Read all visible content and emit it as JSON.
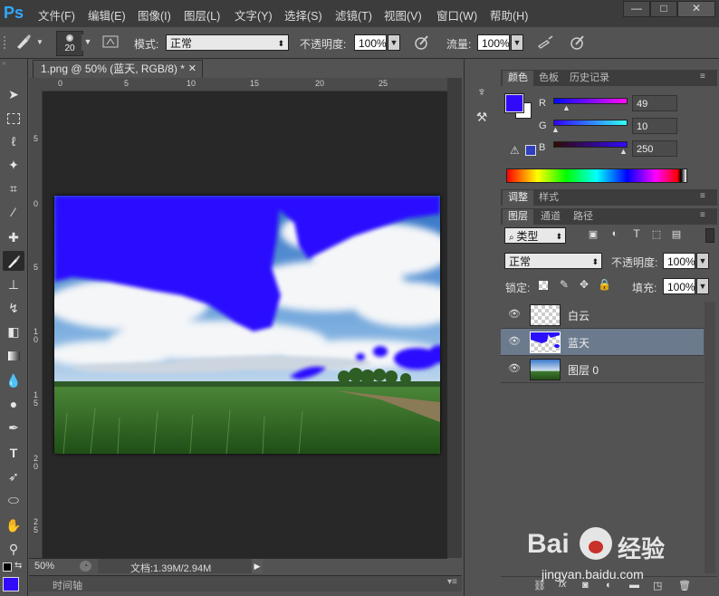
{
  "app": {
    "logo": "Ps"
  },
  "menu": [
    "文件(F)",
    "编辑(E)",
    "图像(I)",
    "图层(L)",
    "文字(Y)",
    "选择(S)",
    "滤镜(T)",
    "视图(V)",
    "窗口(W)",
    "帮助(H)"
  ],
  "window_controls": {
    "minimize": "—",
    "maximize": "□",
    "close": "✕"
  },
  "options": {
    "brush_size": "20",
    "mode_label": "模式:",
    "mode_value": "正常",
    "opacity_label": "不透明度:",
    "opacity_value": "100%",
    "flow_label": "流量:",
    "flow_value": "100%"
  },
  "document": {
    "tab_title": "1.png @ 50% (蓝天, RGB/8) *",
    "ruler_top_labels": [
      "0",
      "5",
      "10",
      "15",
      "20",
      "25"
    ],
    "ruler_left_labels": [
      "5",
      "0",
      "5",
      "1\n0",
      "1\n5",
      "2\n0",
      "2\n5"
    ],
    "zoom": "50%",
    "doc_info": "文档:1.39M/2.94M"
  },
  "timeline": {
    "label": "时间轴"
  },
  "color_panel": {
    "tabs": [
      "颜色",
      "色板",
      "历史记录"
    ],
    "r_label": "R",
    "r_value": "49",
    "g_label": "G",
    "g_value": "10",
    "b_label": "B",
    "b_value": "250",
    "foreground": "#310afa",
    "background": "#ffffff"
  },
  "adjust_panel": {
    "tabs": [
      "调整",
      "样式"
    ]
  },
  "layers_panel": {
    "tabs": [
      "图层",
      "通道",
      "路径"
    ],
    "filter_label": "类型",
    "blend_mode": "正常",
    "opacity_label": "不透明度:",
    "opacity_value": "100%",
    "lock_label": "锁定:",
    "fill_label": "填充:",
    "fill_value": "100%",
    "layers": [
      {
        "name": "白云",
        "active": false
      },
      {
        "name": "蓝天",
        "active": true
      },
      {
        "name": "图层 0",
        "active": false
      }
    ],
    "footer_icons": [
      "link-icon",
      "fx-icon",
      "mask-icon",
      "adjustment-icon",
      "group-icon",
      "new-layer-icon",
      "trash-icon"
    ]
  },
  "watermark": {
    "brand": "Bai",
    "brand2": "经验",
    "url": "jingyan.baidu.com"
  }
}
